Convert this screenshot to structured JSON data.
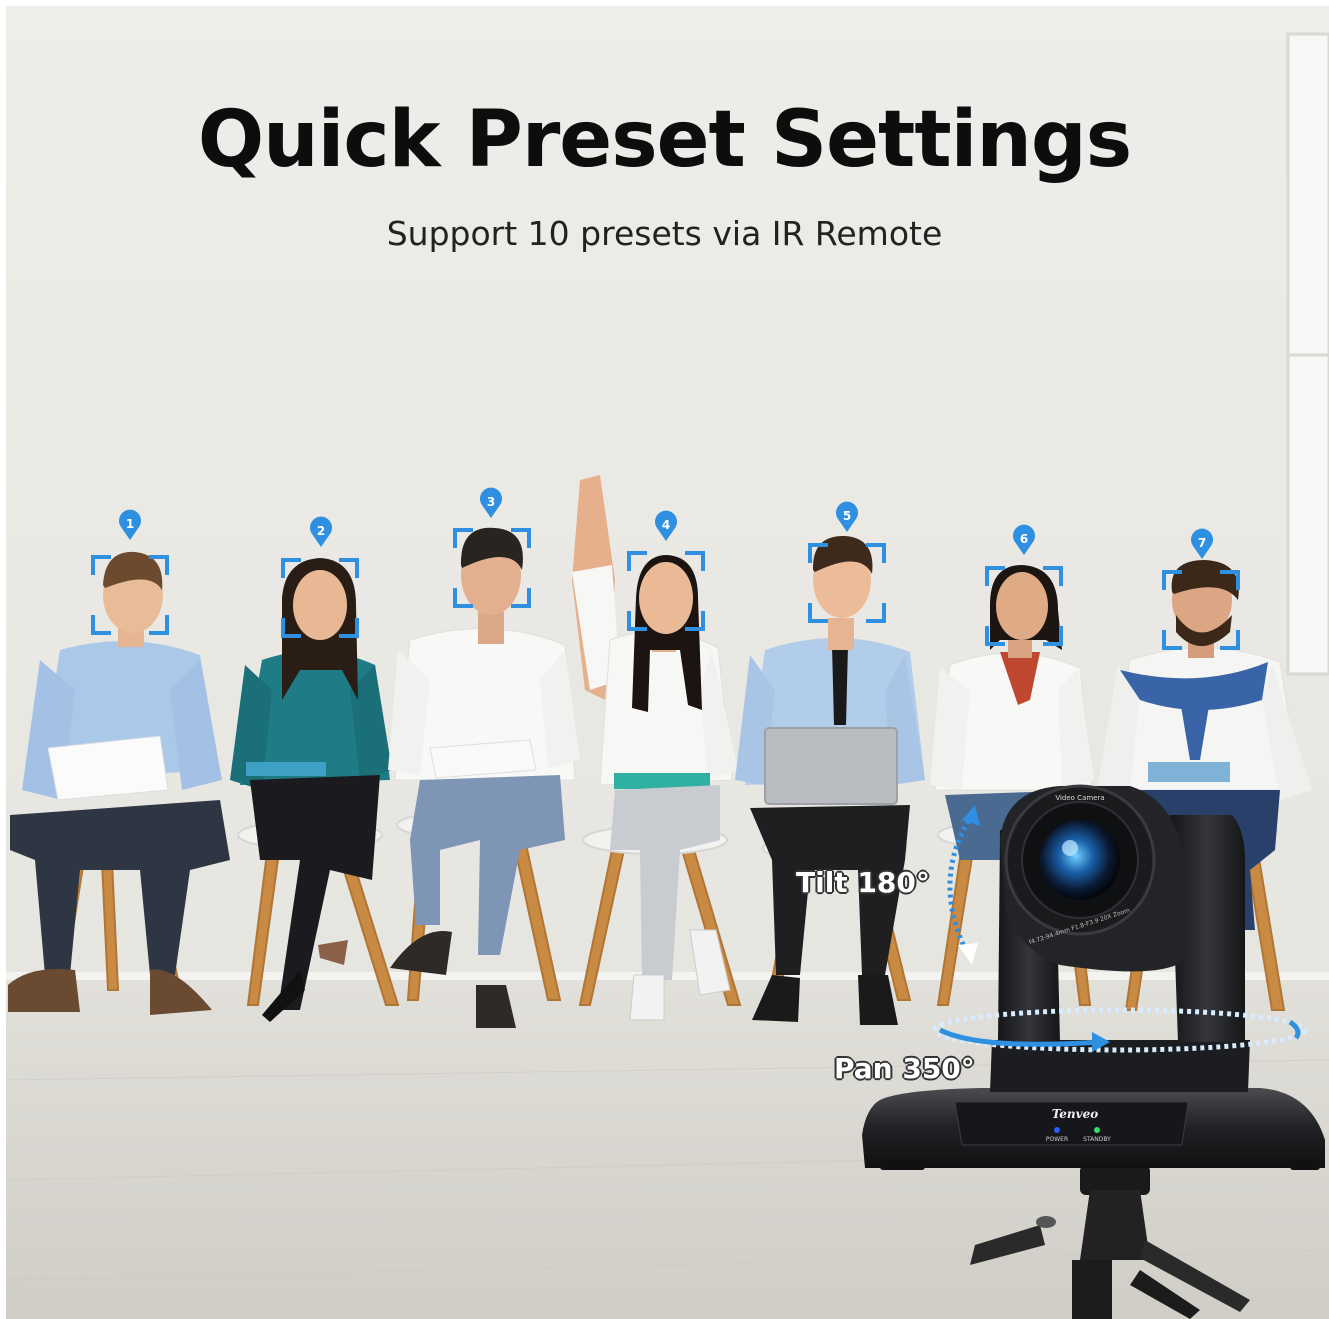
{
  "heading": {
    "title": "Quick Preset Settings",
    "subtitle": "Support 10 presets via IR Remote"
  },
  "presets": [
    "1",
    "2",
    "3",
    "4",
    "5",
    "6",
    "7"
  ],
  "camera": {
    "brand": "Tenveo",
    "lens_text": "Video Camera",
    "lens_spec": "f4.72-94.4mm F1.8-F3.9 20X Zoom",
    "power_label": "POWER",
    "standby_label": "STANDBY",
    "tilt_label": "Tilt 180°",
    "pan_label": "Pan 350°"
  },
  "colors": {
    "focus_box": "#2f8fe0",
    "wall": "#ecebe6",
    "floor": "#dcdad4",
    "camera_body": "#1f2022"
  }
}
